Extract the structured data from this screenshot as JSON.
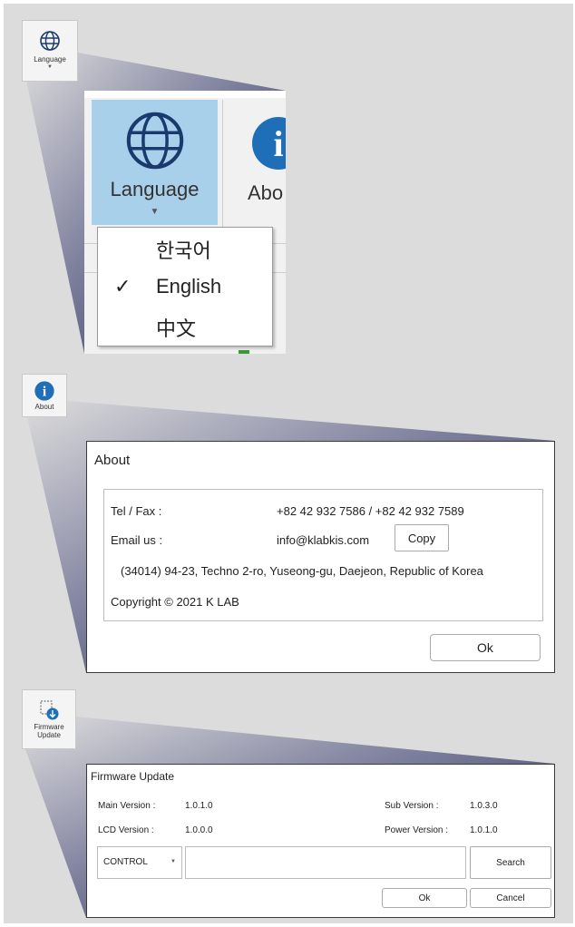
{
  "language_tool": {
    "label": "Language"
  },
  "language_ribbon": {
    "button_label": "Language",
    "about_partial_label": "Abo",
    "menu": [
      {
        "label": "한국어",
        "checked": false
      },
      {
        "label": "English",
        "checked": true
      },
      {
        "label": "中文",
        "checked": false
      }
    ],
    "check_mark": "✓"
  },
  "about_tool": {
    "label": "About"
  },
  "about_dialog": {
    "title": "About",
    "tel_label": "Tel / Fax :",
    "tel_value": "+82 42 932 7586 / +82 42 932 7589",
    "email_label": "Email us :",
    "email_value": "info@klabkis.com",
    "copy_label": "Copy",
    "address": "(34014) 94-23, Techno 2-ro, Yuseong-gu, Daejeon, Republic of Korea",
    "copyright": "Copyright ©  2021 K LAB",
    "ok_label": "Ok"
  },
  "firmware_tool": {
    "label_line1": "Firmware",
    "label_line2": "Update"
  },
  "firmware_dialog": {
    "title": "Firmware Update",
    "main_version_label": "Main Version :",
    "main_version_value": "1.0.1.0",
    "sub_version_label": "Sub Version :",
    "sub_version_value": "1.0.3.0",
    "lcd_version_label": "LCD Version :",
    "lcd_version_value": "1.0.0.0",
    "power_version_label": "Power Version :",
    "power_version_value": "1.0.1.0",
    "target_select": "CONTROL",
    "file_path": "",
    "search_label": "Search",
    "ok_label": "Ok",
    "cancel_label": "Cancel"
  },
  "colors": {
    "canvas": "#dcdcdc",
    "highlight": "#a8d0ea",
    "funnel_dark": "#2a2d57",
    "info_blue": "#1f6fb8"
  }
}
